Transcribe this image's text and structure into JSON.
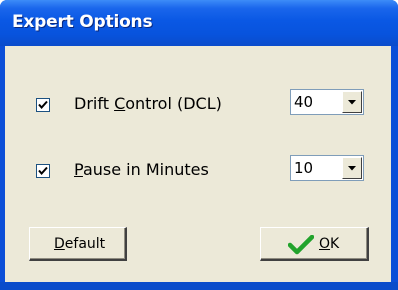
{
  "window": {
    "title": "Expert Options"
  },
  "options": [
    {
      "checked": true,
      "label_pre": "Drift ",
      "label_mnemonic": "C",
      "label_post": "ontrol (DCL)",
      "value": "40"
    },
    {
      "checked": true,
      "label_pre": "",
      "label_mnemonic": "P",
      "label_post": "ause in Minutes",
      "value": "10"
    }
  ],
  "buttons": {
    "default_mnemonic": "D",
    "default_rest": "efault",
    "ok_mnemonic": "O",
    "ok_rest": "K"
  },
  "icons": {
    "checkbox_mark": "check-icon",
    "dropdown_arrow": "chevron-down-icon",
    "ok_icon": "green-checkmark-icon"
  },
  "colors": {
    "titlebar": "#0a58e4",
    "face": "#ece9d8",
    "ok_check": "#22a32c"
  }
}
